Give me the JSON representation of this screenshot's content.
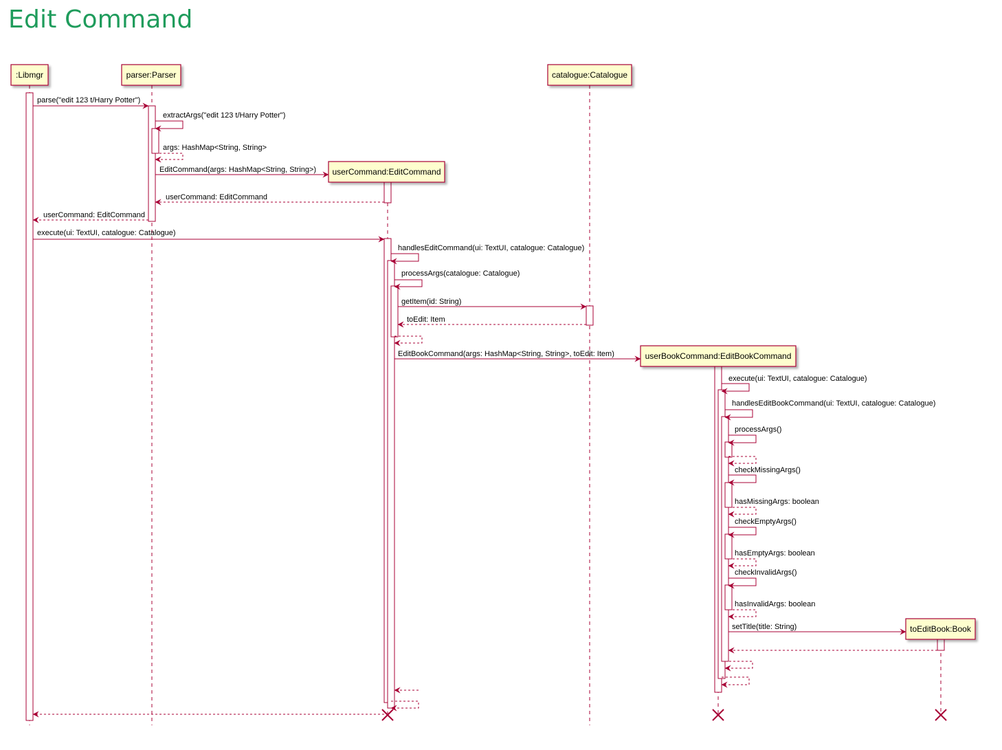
{
  "title": "Edit Command",
  "colors": {
    "title": "#1f9c5c",
    "arrow": "#a80036",
    "participant_fill": "#fefece",
    "participant_border": "#a80036"
  },
  "participants": [
    {
      "id": "libmgr",
      "label": ":Libmgr"
    },
    {
      "id": "parser",
      "label": "parser:Parser"
    },
    {
      "id": "userCommand",
      "label": "userCommand:EditCommand"
    },
    {
      "id": "catalogue",
      "label": "catalogue:Catalogue"
    },
    {
      "id": "userBookCommand",
      "label": "userBookCommand:EditBookCommand"
    },
    {
      "id": "toEditBook",
      "label": "toEditBook:Book"
    }
  ],
  "messages": [
    {
      "text": "parse(\"edit 123 t/Harry Potter\")"
    },
    {
      "text": "extractArgs(\"edit 123 t/Harry Potter\")"
    },
    {
      "text": "args: HashMap<String, String>"
    },
    {
      "text": "EditCommand(args: HashMap<String, String>)"
    },
    {
      "text": "userCommand: EditCommand"
    },
    {
      "text": "userCommand: EditCommand"
    },
    {
      "text": "execute(ui: TextUI, catalogue: Catalogue)"
    },
    {
      "text": "handlesEditCommand(ui: TextUI, catalogue: Catalogue)"
    },
    {
      "text": "processArgs(catalogue: Catalogue)"
    },
    {
      "text": "getItem(id: String)"
    },
    {
      "text": "toEdit: Item"
    },
    {
      "text": ""
    },
    {
      "text": "EditBookCommand(args: HashMap<String, String>, toEdit: Item)"
    },
    {
      "text": "execute(ui: TextUI, catalogue: Catalogue)"
    },
    {
      "text": "handlesEditBookCommand(ui: TextUI, catalogue: Catalogue)"
    },
    {
      "text": "processArgs()"
    },
    {
      "text": ""
    },
    {
      "text": "checkMissingArgs()"
    },
    {
      "text": "hasMissingArgs: boolean"
    },
    {
      "text": "checkEmptyArgs()"
    },
    {
      "text": "hasEmptyArgs: boolean"
    },
    {
      "text": "checkInvalidArgs()"
    },
    {
      "text": "hasInvalidArgs: boolean"
    },
    {
      "text": "setTitle(title: String)"
    },
    {
      "text": ""
    },
    {
      "text": ""
    },
    {
      "text": ""
    },
    {
      "text": ""
    },
    {
      "text": ""
    },
    {
      "text": ""
    }
  ]
}
